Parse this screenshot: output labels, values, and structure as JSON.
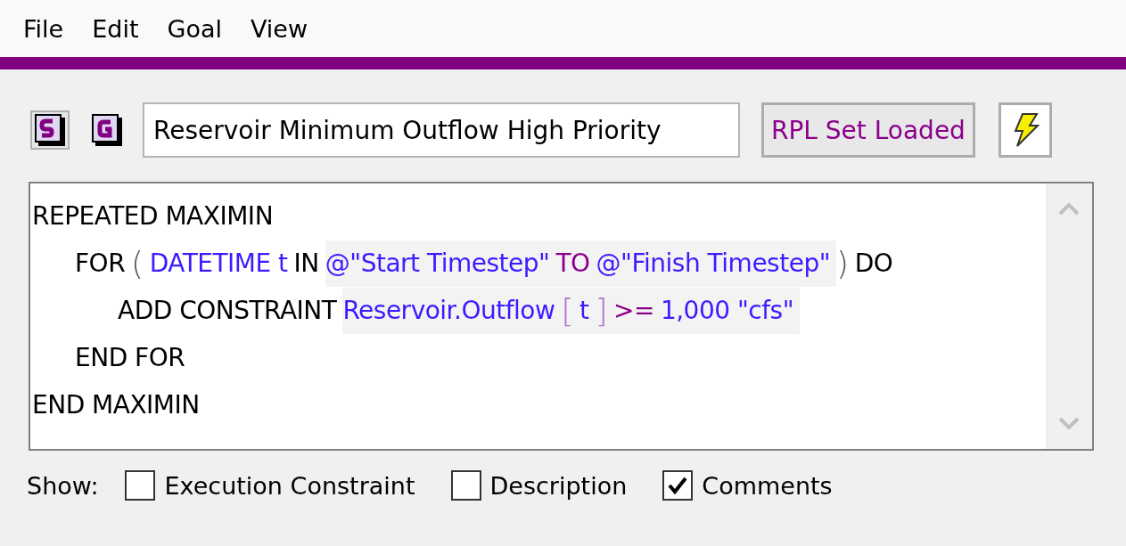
{
  "menu": [
    "File",
    "Edit",
    "Goal",
    "View"
  ],
  "toolbar": {
    "goal_name": "Reservoir Minimum Outflow High Priority",
    "status": "RPL Set Loaded"
  },
  "code": [
    {
      "tokens": [
        {
          "kind": "keyword",
          "text": "REPEATED MAXIMIN"
        }
      ],
      "children": [
        {
          "tokens": [
            {
              "kind": "keyword",
              "text": "FOR"
            },
            {
              "kind": "paren",
              "text": "("
            },
            {
              "kind": "name",
              "text": "DATETIME t"
            },
            {
              "kind": "keyword",
              "text": "IN"
            },
            {
              "kind": "hl-name",
              "text": "@\"Start Timestep\""
            },
            {
              "kind": "hl-op",
              "text": "TO"
            },
            {
              "kind": "hl-name",
              "text": "@\"Finish Timestep\""
            },
            {
              "kind": "paren",
              "text": ")"
            },
            {
              "kind": "keyword",
              "text": "DO"
            }
          ],
          "children": [
            {
              "tokens": [
                {
                  "kind": "keyword",
                  "text": "ADD CONSTRAINT"
                },
                {
                  "kind": "hl-name",
                  "text": "Reservoir.Outflow"
                },
                {
                  "kind": "hl-bracket",
                  "text": "["
                },
                {
                  "kind": "hl-name",
                  "text": "t"
                },
                {
                  "kind": "hl-bracket",
                  "text": "]"
                },
                {
                  "kind": "hl-op",
                  "text": ">="
                },
                {
                  "kind": "hl-name",
                  "text": "1,000 \"cfs\""
                }
              ]
            }
          ]
        },
        {
          "tokens": [
            {
              "kind": "keyword",
              "text": "END FOR"
            }
          ]
        }
      ]
    },
    {
      "tokens": [
        {
          "kind": "keyword",
          "text": "END MAXIMIN"
        }
      ]
    }
  ],
  "show": {
    "label": "Show:",
    "options": [
      {
        "label": "Execution Constraint",
        "checked": false
      },
      {
        "label": "Description",
        "checked": false
      },
      {
        "label": "Comments",
        "checked": true
      }
    ]
  }
}
